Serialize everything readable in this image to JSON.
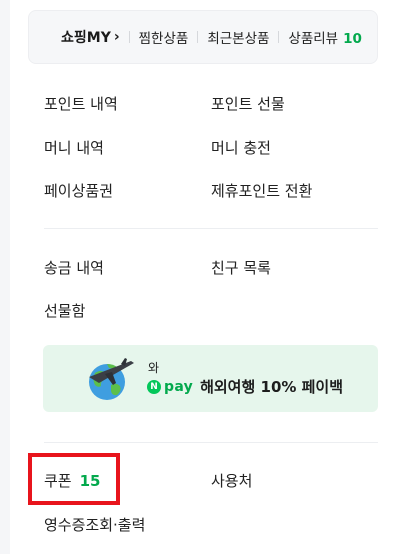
{
  "top_bar": {
    "shopping_my_label": "쇼핑MY",
    "chevron": "›",
    "wishlist_label": "찜한상품",
    "recent_label": "최근본상품",
    "reviews_label": "상품리뷰",
    "reviews_count": "10"
  },
  "points_section": {
    "point_history": "포인트 내역",
    "point_gift": "포인트 선물",
    "money_history": "머니 내역",
    "money_charge": "머니 충전",
    "pay_voucher": "페이상품권",
    "partner_point_convert": "제휴포인트 전환"
  },
  "transfer_section": {
    "transfer_history": "송금 내역",
    "friend_list": "친구 목록",
    "gift_box": "선물함"
  },
  "banner": {
    "with_label": "와",
    "npay_n": "N",
    "npay_pay": "pay",
    "promo_text": "해외여행 10% 페이백",
    "icon": "globe-airplane-icon"
  },
  "bottom_section": {
    "coupon_label": "쿠폰",
    "coupon_count": "15",
    "merchants_label": "사용처",
    "receipt_label": "영수증조회·출력"
  },
  "colors": {
    "accent_green": "#03a94d",
    "highlight_red": "#e8141c",
    "banner_bg": "#e6f6ec"
  }
}
